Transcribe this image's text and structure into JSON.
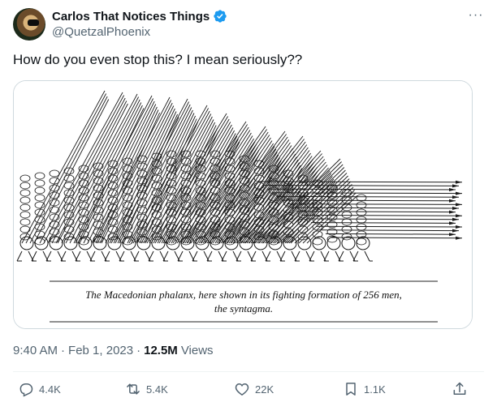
{
  "author": {
    "display_name": "Carlos That Notices Things",
    "handle": "@QuetzalPhoenix",
    "verified": true
  },
  "tweet": {
    "text": "How do you even stop this? I mean seriously??",
    "time": "9:40 AM",
    "separator": "·",
    "date": "Feb 1, 2023",
    "views_count": "12.5M",
    "views_label": "Views"
  },
  "media": {
    "caption_line1": "The Macedonian phalanx, here shown in its fighting formation of 256 men,",
    "caption_line2": "the syntagma."
  },
  "actions": {
    "replies": "4.4K",
    "reposts": "5.4K",
    "likes": "22K",
    "bookmarks": "1.1K"
  },
  "icons": {
    "more": "more-dots-icon",
    "verified": "verified-badge-icon",
    "reply": "reply-icon",
    "repost": "repost-icon",
    "like": "heart-icon",
    "bookmark": "bookmark-icon",
    "share": "share-icon"
  },
  "colors": {
    "verified_blue": "#1d9bf0",
    "muted_text": "#536471",
    "primary_text": "#0f1419"
  }
}
